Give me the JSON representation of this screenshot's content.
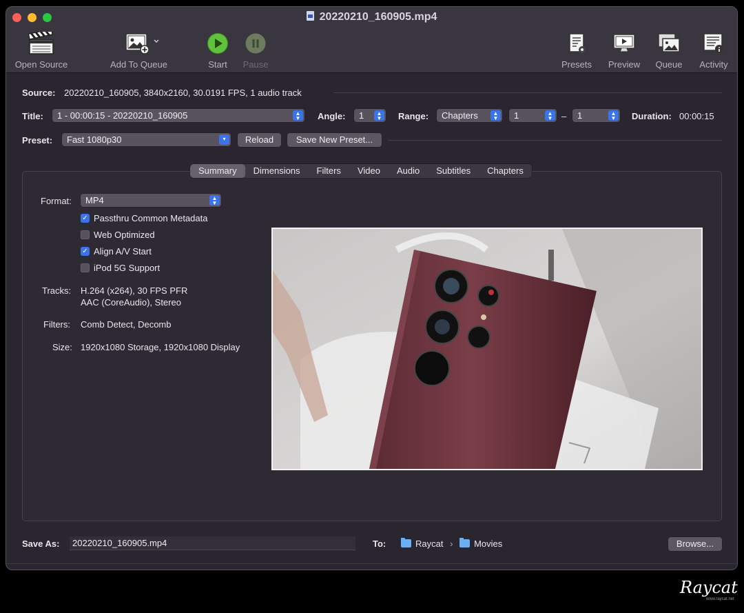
{
  "window": {
    "title": "20220210_160905.mp4"
  },
  "toolbar": {
    "open_source": "Open Source",
    "add_to_queue": "Add To Queue",
    "start": "Start",
    "pause": "Pause",
    "presets": "Presets",
    "preview": "Preview",
    "queue": "Queue",
    "activity": "Activity"
  },
  "source": {
    "label": "Source:",
    "value": "20220210_160905, 3840x2160, 30.0191 FPS, 1 audio track"
  },
  "title_row": {
    "label": "Title:",
    "value": "1 - 00:00:15 - 20220210_160905",
    "angle_label": "Angle:",
    "angle_value": "1",
    "range_label": "Range:",
    "range_type": "Chapters",
    "range_start": "1",
    "range_sep": "–",
    "range_end": "1",
    "duration_label": "Duration:",
    "duration_value": "00:00:15"
  },
  "preset_row": {
    "label": "Preset:",
    "value": "Fast 1080p30",
    "reload": "Reload",
    "save_new": "Save New Preset..."
  },
  "tabs": [
    "Summary",
    "Dimensions",
    "Filters",
    "Video",
    "Audio",
    "Subtitles",
    "Chapters"
  ],
  "summary": {
    "format_label": "Format:",
    "format_value": "MP4",
    "options": [
      {
        "label": "Passthru Common Metadata",
        "checked": true
      },
      {
        "label": "Web Optimized",
        "checked": false
      },
      {
        "label": "Align A/V Start",
        "checked": true
      },
      {
        "label": "iPod 5G Support",
        "checked": false
      }
    ],
    "tracks_label": "Tracks:",
    "tracks_line1": "H.264 (x264), 30 FPS PFR",
    "tracks_line2": "AAC (CoreAudio), Stereo",
    "filters_label": "Filters:",
    "filters_value": "Comb Detect, Decomb",
    "size_label": "Size:",
    "size_value": "1920x1080 Storage, 1920x1080 Display"
  },
  "save": {
    "label": "Save As:",
    "filename": "20220210_160905.mp4",
    "to_label": "To:",
    "path": [
      "Raycat",
      "Movies"
    ],
    "browse": "Browse..."
  },
  "watermark": {
    "text": "Raycat",
    "sub": "www.raycat.net"
  },
  "colors": {
    "accent": "#3b73e8",
    "window_bg": "#2a2630",
    "start_green": "#5fbf3b"
  }
}
